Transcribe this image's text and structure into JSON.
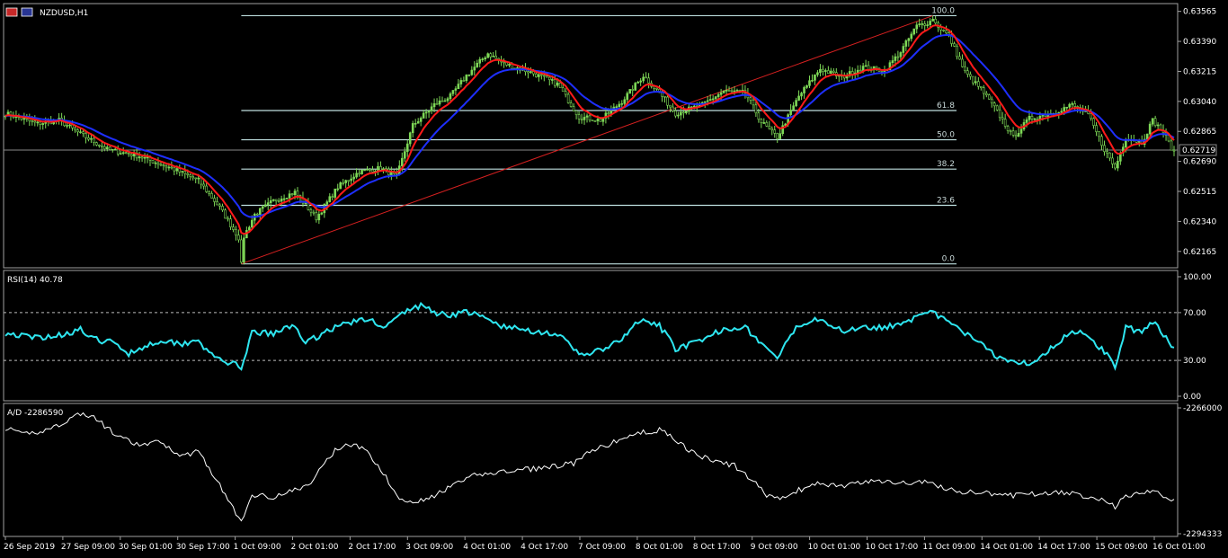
{
  "window": {
    "symbol_label": "NZDUSD,H1"
  },
  "colors": {
    "background": "#000000",
    "candle": "#7ED957",
    "ma_fast": "#FF1A1A",
    "ma_slow": "#1E2FFF",
    "fib": "#BFE0E0",
    "trendline": "#D42020",
    "rsi": "#2EE6F0",
    "ad": "#FFFFFF",
    "grid": "#A0A0A0",
    "price_line": "#8A8A8A"
  },
  "chart_data": [
    {
      "type": "candlestick",
      "title": "NZDUSD,H1",
      "x_ticks": [
        "26 Sep 2019",
        "27 Sep 09:00",
        "30 Sep 01:00",
        "30 Sep 17:00",
        "1 Oct 09:00",
        "2 Oct 01:00",
        "2 Oct 17:00",
        "3 Oct 09:00",
        "4 Oct 01:00",
        "4 Oct 17:00",
        "7 Oct 09:00",
        "8 Oct 01:00",
        "8 Oct 17:00",
        "9 Oct 09:00",
        "10 Oct 01:00",
        "10 Oct 17:00",
        "11 Oct 09:00",
        "14 Oct 01:00",
        "14 Oct 17:00",
        "15 Oct 09:00",
        "16 Oct 01:00"
      ],
      "y_ticks": [
        "0.63565",
        "0.63390",
        "0.63215",
        "0.63040",
        "0.62865",
        "0.62690",
        "0.62515",
        "0.62340",
        "0.62165"
      ],
      "ylim": [
        0.6208,
        0.636
      ],
      "current_price": "0.62719",
      "close_anchors": [
        [
          0,
          0.6297
        ],
        [
          12,
          0.6291
        ],
        [
          20,
          0.6293
        ],
        [
          28,
          0.6285
        ],
        [
          38,
          0.6276
        ],
        [
          50,
          0.6272
        ],
        [
          62,
          0.6265
        ],
        [
          72,
          0.6258
        ],
        [
          80,
          0.6242
        ],
        [
          88,
          0.6222
        ],
        [
          93,
          0.6238
        ],
        [
          100,
          0.6246
        ],
        [
          108,
          0.6251
        ],
        [
          116,
          0.6236
        ],
        [
          124,
          0.6254
        ],
        [
          132,
          0.6263
        ],
        [
          140,
          0.6265
        ],
        [
          146,
          0.626
        ],
        [
          152,
          0.629
        ],
        [
          160,
          0.6302
        ],
        [
          166,
          0.6307
        ],
        [
          172,
          0.6319
        ],
        [
          180,
          0.6332
        ],
        [
          186,
          0.6326
        ],
        [
          196,
          0.6321
        ],
        [
          206,
          0.6314
        ],
        [
          214,
          0.6295
        ],
        [
          222,
          0.6293
        ],
        [
          230,
          0.6304
        ],
        [
          238,
          0.6319
        ],
        [
          244,
          0.6309
        ],
        [
          250,
          0.6297
        ],
        [
          260,
          0.6302
        ],
        [
          268,
          0.631
        ],
        [
          276,
          0.6309
        ],
        [
          282,
          0.6292
        ],
        [
          288,
          0.6283
        ],
        [
          296,
          0.6307
        ],
        [
          304,
          0.6323
        ],
        [
          312,
          0.6318
        ],
        [
          320,
          0.6324
        ],
        [
          328,
          0.6322
        ],
        [
          334,
          0.6333
        ],
        [
          340,
          0.6348
        ],
        [
          346,
          0.6351
        ],
        [
          352,
          0.6342
        ],
        [
          358,
          0.6321
        ],
        [
          364,
          0.6311
        ],
        [
          370,
          0.6298
        ],
        [
          376,
          0.6283
        ],
        [
          382,
          0.6294
        ],
        [
          390,
          0.6297
        ],
        [
          398,
          0.6302
        ],
        [
          404,
          0.6296
        ],
        [
          410,
          0.6276
        ],
        [
          414,
          0.6265
        ],
        [
          418,
          0.6283
        ],
        [
          424,
          0.628
        ],
        [
          428,
          0.6293
        ],
        [
          432,
          0.6286
        ],
        [
          436,
          0.6274
        ]
      ],
      "low_anchor": {
        "bar": 88,
        "price": 0.62092
      },
      "high_anchor": {
        "bar": 346,
        "price": 0.6354
      },
      "moving_averages": [
        {
          "name": "fast",
          "period": 8
        },
        {
          "name": "slow",
          "period": 20
        }
      ],
      "fibonacci": {
        "levels": [
          "100.0",
          "61.8",
          "50.0",
          "38.2",
          "23.6",
          "0.0"
        ],
        "low_price": 0.62092,
        "high_price": 0.6354,
        "start_bar": 88,
        "end_bar": 346
      },
      "trendline": {
        "from": {
          "bar": 88,
          "price": 0.62092
        },
        "to": {
          "bar": 346,
          "price": 0.6354
        }
      }
    },
    {
      "type": "line",
      "title": "RSI(14) 40.78",
      "y_ticks": [
        "100.00",
        "70.00",
        "30.00",
        "0.00"
      ],
      "ylim": [
        0,
        100
      ],
      "levels": [
        70,
        30
      ],
      "value_anchors": [
        [
          0,
          53
        ],
        [
          10,
          49
        ],
        [
          20,
          51
        ],
        [
          28,
          56
        ],
        [
          32,
          48
        ],
        [
          40,
          45
        ],
        [
          46,
          36
        ],
        [
          50,
          40
        ],
        [
          58,
          47
        ],
        [
          66,
          44
        ],
        [
          72,
          48
        ],
        [
          76,
          35
        ],
        [
          80,
          31
        ],
        [
          86,
          26
        ],
        [
          88,
          20
        ],
        [
          92,
          54
        ],
        [
          100,
          52
        ],
        [
          108,
          60
        ],
        [
          112,
          44
        ],
        [
          120,
          55
        ],
        [
          128,
          62
        ],
        [
          136,
          64
        ],
        [
          142,
          58
        ],
        [
          148,
          69
        ],
        [
          152,
          74
        ],
        [
          156,
          76
        ],
        [
          160,
          70
        ],
        [
          166,
          68
        ],
        [
          172,
          71
        ],
        [
          180,
          64
        ],
        [
          186,
          58
        ],
        [
          196,
          55
        ],
        [
          206,
          52
        ],
        [
          214,
          35
        ],
        [
          222,
          38
        ],
        [
          230,
          47
        ],
        [
          236,
          63
        ],
        [
          244,
          59
        ],
        [
          250,
          40
        ],
        [
          260,
          46
        ],
        [
          268,
          57
        ],
        [
          276,
          58
        ],
        [
          282,
          44
        ],
        [
          288,
          32
        ],
        [
          296,
          60
        ],
        [
          304,
          66
        ],
        [
          312,
          54
        ],
        [
          320,
          59
        ],
        [
          328,
          57
        ],
        [
          334,
          62
        ],
        [
          340,
          66
        ],
        [
          346,
          70
        ],
        [
          352,
          62
        ],
        [
          358,
          52
        ],
        [
          364,
          46
        ],
        [
          370,
          33
        ],
        [
          376,
          30
        ],
        [
          382,
          27
        ],
        [
          390,
          40
        ],
        [
          398,
          55
        ],
        [
          404,
          51
        ],
        [
          410,
          37
        ],
        [
          414,
          25
        ],
        [
          418,
          58
        ],
        [
          424,
          53
        ],
        [
          428,
          62
        ],
        [
          432,
          52
        ],
        [
          436,
          40.78
        ]
      ]
    },
    {
      "type": "line",
      "title": "A/D -2286590",
      "y_ticks": [
        "-2266000",
        "-2294333"
      ],
      "ylim": [
        -2294333,
        -2266000
      ],
      "value_anchors": [
        [
          0,
          -2270500
        ],
        [
          6,
          -2272000
        ],
        [
          14,
          -2271200
        ],
        [
          20,
          -2269800
        ],
        [
          28,
          -2267200
        ],
        [
          34,
          -2268500
        ],
        [
          42,
          -2272500
        ],
        [
          50,
          -2274500
        ],
        [
          58,
          -2273600
        ],
        [
          66,
          -2277000
        ],
        [
          72,
          -2275500
        ],
        [
          76,
          -2279500
        ],
        [
          80,
          -2283500
        ],
        [
          84,
          -2287500
        ],
        [
          88,
          -2292000
        ],
        [
          92,
          -2285500
        ],
        [
          100,
          -2286000
        ],
        [
          108,
          -2284500
        ],
        [
          114,
          -2283200
        ],
        [
          118,
          -2279000
        ],
        [
          124,
          -2275000
        ],
        [
          130,
          -2274000
        ],
        [
          136,
          -2276500
        ],
        [
          142,
          -2281500
        ],
        [
          146,
          -2286000
        ],
        [
          152,
          -2287000
        ],
        [
          158,
          -2286500
        ],
        [
          164,
          -2284500
        ],
        [
          170,
          -2282500
        ],
        [
          176,
          -2281000
        ],
        [
          184,
          -2280500
        ],
        [
          192,
          -2280000
        ],
        [
          200,
          -2279500
        ],
        [
          206,
          -2279000
        ],
        [
          212,
          -2278500
        ],
        [
          218,
          -2276000
        ],
        [
          226,
          -2274000
        ],
        [
          232,
          -2272500
        ],
        [
          238,
          -2271500
        ],
        [
          244,
          -2271000
        ],
        [
          250,
          -2273000
        ],
        [
          256,
          -2276000
        ],
        [
          264,
          -2278000
        ],
        [
          272,
          -2279000
        ],
        [
          278,
          -2282000
        ],
        [
          284,
          -2285500
        ],
        [
          290,
          -2286500
        ],
        [
          296,
          -2284500
        ],
        [
          304,
          -2283000
        ],
        [
          312,
          -2283600
        ],
        [
          320,
          -2282800
        ],
        [
          328,
          -2282400
        ],
        [
          336,
          -2283000
        ],
        [
          342,
          -2282500
        ],
        [
          350,
          -2284000
        ],
        [
          358,
          -2285000
        ],
        [
          366,
          -2285200
        ],
        [
          374,
          -2285800
        ],
        [
          382,
          -2285400
        ],
        [
          390,
          -2285000
        ],
        [
          398,
          -2285400
        ],
        [
          404,
          -2285900
        ],
        [
          410,
          -2286700
        ],
        [
          414,
          -2288200
        ],
        [
          418,
          -2285800
        ],
        [
          424,
          -2285000
        ],
        [
          428,
          -2284600
        ],
        [
          432,
          -2286000
        ],
        [
          436,
          -2286590
        ]
      ]
    }
  ]
}
